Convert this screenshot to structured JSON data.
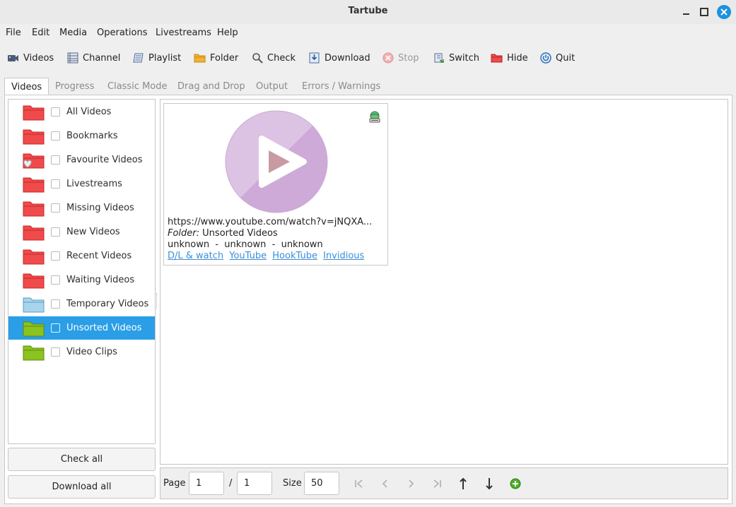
{
  "window": {
    "title": "Tartube"
  },
  "menu": [
    "File",
    "Edit",
    "Media",
    "Operations",
    "Livestreams",
    "Help"
  ],
  "toolbar": {
    "videos": "Videos",
    "channel": "Channel",
    "playlist": "Playlist",
    "folder": "Folder",
    "check": "Check",
    "download": "Download",
    "stop": "Stop",
    "switch": "Switch",
    "hide": "Hide",
    "quit": "Quit"
  },
  "tabs": [
    "Videos",
    "Progress",
    "Classic Mode",
    "Drag and Drop",
    "Output",
    "Errors / Warnings"
  ],
  "sidebar": {
    "items": [
      {
        "label": "All Videos",
        "color": "red"
      },
      {
        "label": "Bookmarks",
        "color": "red"
      },
      {
        "label": "Favourite Videos",
        "color": "red"
      },
      {
        "label": "Livestreams",
        "color": "red"
      },
      {
        "label": "Missing Videos",
        "color": "red"
      },
      {
        "label": "New Videos",
        "color": "red"
      },
      {
        "label": "Recent Videos",
        "color": "red"
      },
      {
        "label": "Waiting Videos",
        "color": "red"
      },
      {
        "label": "Temporary Videos",
        "color": "blue"
      },
      {
        "label": "Unsorted Videos",
        "color": "green"
      },
      {
        "label": "Video Clips",
        "color": "green"
      }
    ],
    "selected_index": 9,
    "check_all": "Check all",
    "download_all": "Download all"
  },
  "video": {
    "url": "https://www.youtube.com/watch?v=jNQXA...",
    "folder_label": "Folder:",
    "folder_value": "Unsorted Videos",
    "meta": "unknown  -  unknown  -  unknown",
    "links": [
      "D/L & watch",
      "YouTube",
      "HookTube",
      "Invidious"
    ]
  },
  "pagination": {
    "page_label": "Page",
    "page_value": "1",
    "separator": "/",
    "total_pages": "1",
    "size_label": "Size",
    "size_value": "50"
  },
  "colors": {
    "selection": "#2a9ee6",
    "link": "#3b8ed8",
    "folder_red": "#ef4b4b",
    "folder_blue": "#9fcfe8",
    "folder_green": "#8cc31f",
    "thumb_purple": "#d2b3dc"
  }
}
